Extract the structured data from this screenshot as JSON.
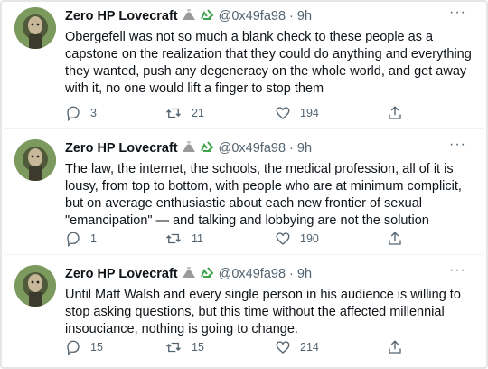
{
  "tweets": [
    {
      "name": "Zero HP Lovecraft",
      "handle": "@0x49fa98",
      "separator": "·",
      "time": "9h",
      "more": "···",
      "text": "Obergefell was not so much a blank check to these people as a capstone on the realization that they could do anything and everything they wanted, push any degeneracy on the whole world, and get away with it, no one would lift a finger to stop them",
      "replies": "3",
      "retweets": "21",
      "likes": "194"
    },
    {
      "name": "Zero HP Lovecraft",
      "handle": "@0x49fa98",
      "separator": "·",
      "time": "9h",
      "more": "···",
      "text": "The law, the internet, the schools, the medical profession, all of it is lousy, from top to bottom, with people who are at minimum complicit, but on average enthusiastic about each new frontier of sexual \"emancipation\" — and talking and lobbying are not the solution",
      "replies": "1",
      "retweets": "11",
      "likes": "190"
    },
    {
      "name": "Zero HP Lovecraft",
      "handle": "@0x49fa98",
      "separator": "·",
      "time": "9h",
      "more": "···",
      "text": "Until Matt Walsh and every single person in his audience is willing to stop asking questions, but this time without the affected millennial insouciance, nothing is going to change.",
      "replies": "15",
      "retweets": "15",
      "likes": "214"
    }
  ],
  "icons": {
    "reply": "reply-icon",
    "retweet": "retweet-icon",
    "like": "heart-icon",
    "share": "share-icon",
    "name_emojis": [
      "volcano-emoji-icon",
      "recycle-emoji-icon"
    ]
  },
  "colors": {
    "text": "#0f1419",
    "secondary": "#536471",
    "recycle_green": "#3fa34d"
  }
}
